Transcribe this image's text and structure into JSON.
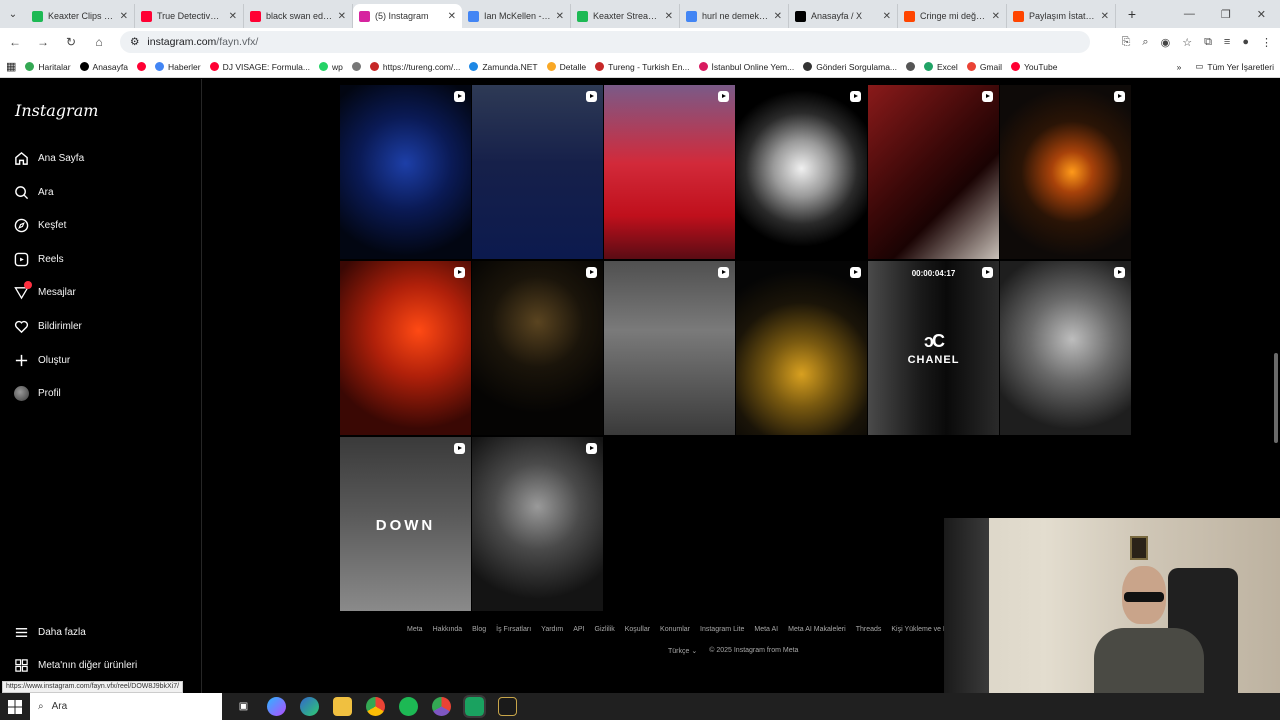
{
  "browser": {
    "tabs": [
      {
        "title": "Kеaxter Clips - W",
        "color": "#1db954",
        "active": false
      },
      {
        "title": "True Detective 1a",
        "color": "#ff0033",
        "active": false
      },
      {
        "title": "black swan edit -",
        "color": "#ff0033",
        "active": false
      },
      {
        "title": "(5) Instagram",
        "color": "#d6249f",
        "active": true
      },
      {
        "title": "Ian McKellen - Go",
        "color": "#4285f4",
        "active": false
      },
      {
        "title": "Kеaxter Stream -",
        "color": "#1db954",
        "active": false
      },
      {
        "title": "hurl ne demek - G",
        "color": "#4285f4",
        "active": false
      },
      {
        "title": "Anasayfa / X",
        "color": "#000000",
        "active": false
      },
      {
        "title": "Cringe mi değil m",
        "color": "#ff4500",
        "active": false
      },
      {
        "title": "Paylaşım İstatistik",
        "color": "#ff4500",
        "active": false
      }
    ],
    "url_host": "instagram.com",
    "url_path": "/fayn.vfx/",
    "bookmarks": [
      {
        "label": "Haritalar",
        "color": "#34a853"
      },
      {
        "label": "Anasayfa",
        "color": "#000000"
      },
      {
        "label": "",
        "color": "#ff0033"
      },
      {
        "label": "Haberler",
        "color": "#4285f4"
      },
      {
        "label": "DJ VISAGE: Formula...",
        "color": "#ff0033"
      },
      {
        "label": "wp",
        "color": "#25d366"
      },
      {
        "label": "",
        "color": "#777777"
      },
      {
        "label": "https://tureng.com/...",
        "color": "#c62828"
      },
      {
        "label": "Zamunda.NET",
        "color": "#1e88e5"
      },
      {
        "label": "Detalle",
        "color": "#f9a825"
      },
      {
        "label": "Tureng - Turkish En...",
        "color": "#c62828"
      },
      {
        "label": "İstanbul Online Yem...",
        "color": "#d81b60"
      },
      {
        "label": "Gönderi Sorgulama...",
        "color": "#333333"
      },
      {
        "label": "",
        "color": "#555555"
      },
      {
        "label": "Excel",
        "color": "#21a366"
      },
      {
        "label": "Gmail",
        "color": "#ea4335"
      },
      {
        "label": "YouTube",
        "color": "#ff0033"
      }
    ],
    "all_bookmarks": "Tüm Yer İşaretleri",
    "status_url": "https://www.instagram.com/fayn.vfx/reel/DOW8J9bkXi7/"
  },
  "instagram": {
    "logo": "Instagram",
    "nav": [
      {
        "label": "Ana Sayfa",
        "icon": "home-icon"
      },
      {
        "label": "Ara",
        "icon": "search-icon"
      },
      {
        "label": "Keşfet",
        "icon": "compass-icon"
      },
      {
        "label": "Reels",
        "icon": "reels-icon"
      },
      {
        "label": "Mesajlar",
        "icon": "messenger-icon"
      },
      {
        "label": "Bildirimler",
        "icon": "heart-icon"
      },
      {
        "label": "Oluştur",
        "icon": "plus-icon"
      },
      {
        "label": "Profil",
        "icon": "avatar"
      }
    ],
    "more": "Daha fazla",
    "meta_products": "Meta'nın diğer ürünleri",
    "tile_overlays": {
      "chanel_time": "00:00:04:17",
      "chanel_brand": "CHANEL",
      "down_text": "DOWN"
    },
    "footer_links": [
      "Meta",
      "Hakkında",
      "Blog",
      "İş Fırsatları",
      "Yardım",
      "API",
      "Gizlilik",
      "Koşullar",
      "Konumlar",
      "Instagram Lite",
      "Meta AI",
      "Meta AI Makaleleri",
      "Threads",
      "Kişi Yükleme ve H"
    ],
    "language": "Türkçe",
    "copyright": "© 2025 Instagram from Meta"
  },
  "taskbar": {
    "search_placeholder": "Ara"
  }
}
